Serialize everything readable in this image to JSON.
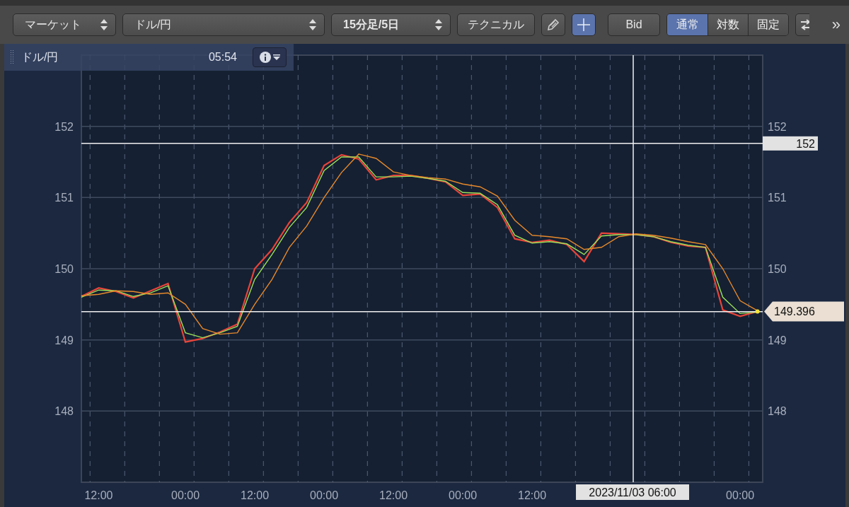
{
  "toolbar": {
    "items": [
      {
        "kind": "select",
        "value": "マーケット",
        "bold": false
      },
      {
        "kind": "select",
        "value": "ドル/円",
        "bold": false
      },
      {
        "kind": "select",
        "value": "15分足/5日",
        "bold": true
      },
      {
        "kind": "button",
        "label": "テクニカル"
      },
      {
        "kind": "pencil",
        "selected": false
      },
      {
        "kind": "crosshair",
        "selected": true
      },
      {
        "kind": "button",
        "label": "Bid"
      },
      {
        "kind": "segmented",
        "options": [
          {
            "label": "通常",
            "selected": true
          },
          {
            "label": "対数",
            "selected": false
          },
          {
            "label": "固定",
            "selected": false
          }
        ]
      },
      {
        "kind": "arrows",
        "selected": false
      },
      {
        "kind": "overflow",
        "label": "»"
      }
    ]
  },
  "chart_panel": {
    "header": {
      "title": "ドル/円",
      "time": "05:54"
    },
    "right_axis_labels": [
      "152",
      "151",
      "150",
      "149",
      "148"
    ],
    "crosshair_time": "2023/11/03 06:00",
    "chart_data": {
      "type": "line",
      "grid": true,
      "ylim": [
        147,
        153
      ],
      "yticks": [
        148,
        149,
        150,
        151,
        152
      ],
      "categories": [
        null,
        "12:00",
        null,
        null,
        null,
        null,
        "00:00",
        null,
        null,
        null,
        "12:00",
        null,
        null,
        null,
        "00:00",
        null,
        null,
        null,
        "12:00",
        null,
        null,
        null,
        "00:00",
        null,
        null,
        null,
        "12:00",
        null,
        null,
        null,
        null,
        null,
        null,
        null,
        null,
        null,
        null,
        null,
        "00:00",
        null
      ],
      "series": [
        {
          "color": "#e8443a",
          "values": [
            149.61,
            149.73,
            149.68,
            149.59,
            149.69,
            149.79,
            148.97,
            149.02,
            149.11,
            149.22,
            150.0,
            150.27,
            150.65,
            150.93,
            151.45,
            151.6,
            151.54,
            151.25,
            151.31,
            151.31,
            151.27,
            151.22,
            151.03,
            151.05,
            150.86,
            150.42,
            150.37,
            150.4,
            150.34,
            150.1,
            150.5,
            150.49,
            150.48,
            150.45,
            150.37,
            150.32,
            150.3,
            149.42,
            149.33,
            149.4
          ]
        },
        {
          "color": "#9be05a",
          "values": [
            149.6,
            149.7,
            149.69,
            149.61,
            149.66,
            149.76,
            149.1,
            149.03,
            149.1,
            149.19,
            149.85,
            150.2,
            150.58,
            150.86,
            151.38,
            151.57,
            151.57,
            151.29,
            151.29,
            151.3,
            151.27,
            151.23,
            151.07,
            151.06,
            150.9,
            150.47,
            150.36,
            150.38,
            150.35,
            150.2,
            150.46,
            150.48,
            150.48,
            150.45,
            150.38,
            150.33,
            150.3,
            149.6,
            149.37,
            149.39
          ]
        },
        {
          "color": "#e8892a",
          "values": [
            149.62,
            149.64,
            149.69,
            149.68,
            149.64,
            149.66,
            149.5,
            149.16,
            149.08,
            149.1,
            149.5,
            149.85,
            150.3,
            150.6,
            151.0,
            151.35,
            151.61,
            151.55,
            151.36,
            151.31,
            151.28,
            151.26,
            151.19,
            151.15,
            151.02,
            150.68,
            150.47,
            150.45,
            150.42,
            150.27,
            150.3,
            150.45,
            150.49,
            150.47,
            150.43,
            150.38,
            150.34,
            150.0,
            149.55,
            149.41
          ]
        }
      ],
      "ref_lines": [
        {
          "axis": "y",
          "value": 151.76,
          "label": "152"
        },
        {
          "axis": "y",
          "value": 149.396
        }
      ],
      "annotations": [
        "149.396"
      ]
    }
  }
}
